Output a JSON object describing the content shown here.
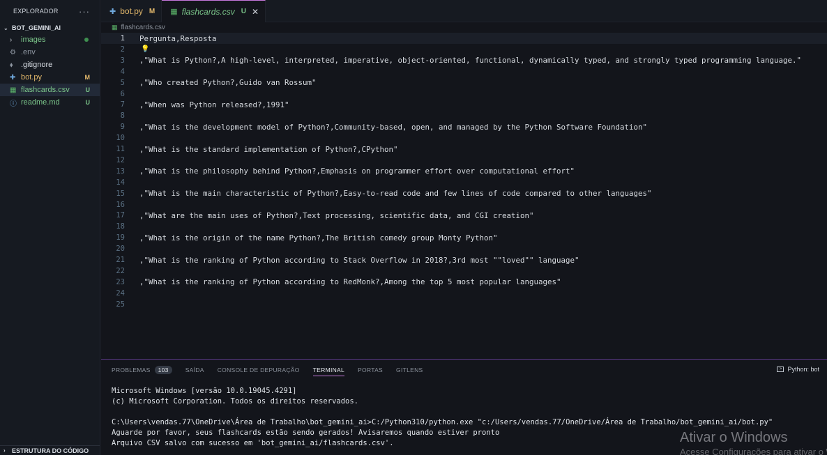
{
  "sidebar": {
    "title": "EXPLORADOR",
    "more": "···",
    "root": "BOT_GEMINI_AI",
    "items": [
      {
        "icon": "›",
        "name": "images",
        "badge": "",
        "color": "#7bc58a"
      },
      {
        "icon": "⚙",
        "name": ".env",
        "badge": "",
        "color": "#9098a3"
      },
      {
        "icon": "⬧",
        "name": ".gitignore",
        "badge": "",
        "color": "#d8dde4"
      },
      {
        "icon": "✚",
        "name": "bot.py",
        "badge": "M",
        "color": "#e2b86b"
      },
      {
        "icon": "▦",
        "name": "flashcards.csv",
        "badge": "U",
        "color": "#7bc58a"
      },
      {
        "icon": "ⓘ",
        "name": "readme.md",
        "badge": "U",
        "color": "#7bc58a"
      }
    ],
    "footer": "ESTRUTURA DO CÓDIGO"
  },
  "tabs": [
    {
      "name": "bot.py",
      "badge": "M"
    },
    {
      "name": "flashcards.csv",
      "badge": "U",
      "close": "✕"
    }
  ],
  "breadcrumb": "flashcards.csv",
  "editor": {
    "lines": [
      {
        "n": "1",
        "text": "Pergunta,Resposta"
      },
      {
        "n": "2",
        "text": ""
      },
      {
        "n": "3",
        "text": ",\"What is Python?,A high-level, interpreted, imperative, object-oriented, functional, dynamically typed, and strongly typed programming language.\""
      },
      {
        "n": "4",
        "text": ""
      },
      {
        "n": "5",
        "text": ",\"Who created Python?,Guido van Rossum\""
      },
      {
        "n": "6",
        "text": ""
      },
      {
        "n": "7",
        "text": ",\"When was Python released?,1991\""
      },
      {
        "n": "8",
        "text": ""
      },
      {
        "n": "9",
        "text": ",\"What is the development model of Python?,Community-based, open, and managed by the Python Software Foundation\""
      },
      {
        "n": "10",
        "text": ""
      },
      {
        "n": "11",
        "text": ",\"What is the standard implementation of Python?,CPython\""
      },
      {
        "n": "12",
        "text": ""
      },
      {
        "n": "13",
        "text": ",\"What is the philosophy behind Python?,Emphasis on programmer effort over computational effort\""
      },
      {
        "n": "14",
        "text": ""
      },
      {
        "n": "15",
        "text": ",\"What is the main characteristic of Python?,Easy-to-read code and few lines of code compared to other languages\""
      },
      {
        "n": "16",
        "text": ""
      },
      {
        "n": "17",
        "text": ",\"What are the main uses of Python?,Text processing, scientific data, and CGI creation\""
      },
      {
        "n": "18",
        "text": ""
      },
      {
        "n": "19",
        "text": ",\"What is the origin of the name Python?,The British comedy group Monty Python\""
      },
      {
        "n": "20",
        "text": ""
      },
      {
        "n": "21",
        "text": ",\"What is the ranking of Python according to Stack Overflow in 2018?,3rd most \"\"loved\"\" language\""
      },
      {
        "n": "22",
        "text": ""
      },
      {
        "n": "23",
        "text": ",\"What is the ranking of Python according to RedMonk?,Among the top 5 most popular languages\""
      },
      {
        "n": "24",
        "text": ""
      },
      {
        "n": "25",
        "text": ""
      }
    ]
  },
  "panel": {
    "tabs": [
      "PROBLEMAS",
      "SAÍDA",
      "CONSOLE DE DEPURAÇÃO",
      "TERMINAL",
      "PORTAS",
      "GITLENS"
    ],
    "problems_count": "103",
    "terminal_label": "Python: bot",
    "terminal_lines": [
      "Microsoft Windows [versão 10.0.19045.4291]",
      "(c) Microsoft Corporation. Todos os direitos reservados.",
      "",
      "C:\\Users\\vendas.77\\OneDrive\\Área de Trabalho\\bot_gemini_ai>C:/Python310/python.exe \"c:/Users/vendas.77/OneDrive/Área de Trabalho/bot_gemini_ai/bot.py\"",
      "Aguarde por favor, seus flashcards estão sendo gerados! Avisaremos quando estiver pronto",
      "Arquivo CSV salvo com sucesso em 'bot_gemini_ai/flashcards.csv'."
    ]
  },
  "watermark": {
    "title": "Ativar o Windows",
    "subtitle": "Acesse Configurações para ativar o Windows."
  }
}
